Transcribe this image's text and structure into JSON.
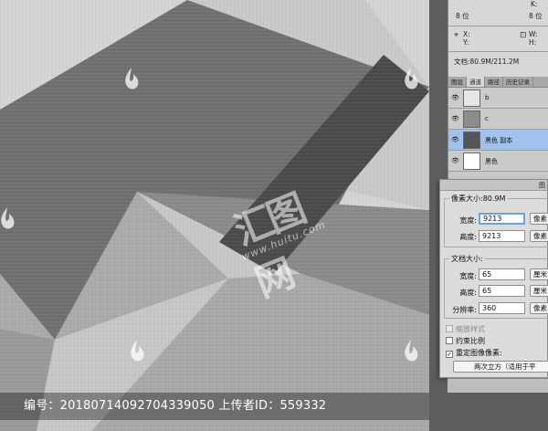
{
  "caption": {
    "id_label": "编号",
    "id_value": "20180714092704339050",
    "uploader_label": "上传者ID",
    "uploader_value": "559332"
  },
  "watermark": {
    "logo_text": "汇图网",
    "url": "www.huitu.com"
  },
  "info_panel": {
    "k_label": "K:",
    "bit_left": "8 位",
    "bit_right": "8 位",
    "x_label": "X:",
    "y_label": "Y:",
    "w_label": "W:",
    "h_label": "H:",
    "doc_text": "文档:80.9M/211.2M"
  },
  "channels_panel": {
    "tabs": [
      "图层",
      "通道",
      "路径",
      "历史记录"
    ],
    "active_tab": 1,
    "channels": [
      {
        "name": "b",
        "visible": true,
        "selected": false,
        "thumb": "#e6e6e6"
      },
      {
        "name": "c",
        "visible": true,
        "selected": false,
        "thumb": "#8c8c8c"
      },
      {
        "name": "黑色 副本",
        "visible": true,
        "selected": true,
        "thumb": "#555555"
      },
      {
        "name": "黑色",
        "visible": true,
        "selected": false,
        "thumb": "#ffffff"
      }
    ]
  },
  "image_size_dialog": {
    "title": "图",
    "pixel_dimensions_label": "像素大小:80.9M",
    "width_label": "宽度:",
    "width_value": "9213",
    "width_unit": "像素",
    "height_label": "高度:",
    "height_value": "9213",
    "height_unit": "像素",
    "document_size_label": "文档大小:",
    "doc_width_label": "宽度:",
    "doc_width_value": "65",
    "doc_width_unit": "厘米",
    "doc_height_label": "高度:",
    "doc_height_value": "65",
    "doc_height_unit": "厘米",
    "resolution_label": "分辨率:",
    "resolution_value": "360",
    "resolution_unit": "像素",
    "scale_styles_label": "缩放样式",
    "scale_styles_checked": false,
    "constrain_label": "约束比例",
    "constrain_checked": false,
    "resample_label": "重定图像像素:",
    "resample_checked": true,
    "resample_method": "两次立方（适用于平"
  },
  "colors": {
    "canvas_light": "#d6d6d6",
    "canvas_mid": "#a2a2a2",
    "canvas_dark": "#6e6e6e",
    "stripe": "#4e4e4e",
    "selection": "#9fc3ee"
  }
}
